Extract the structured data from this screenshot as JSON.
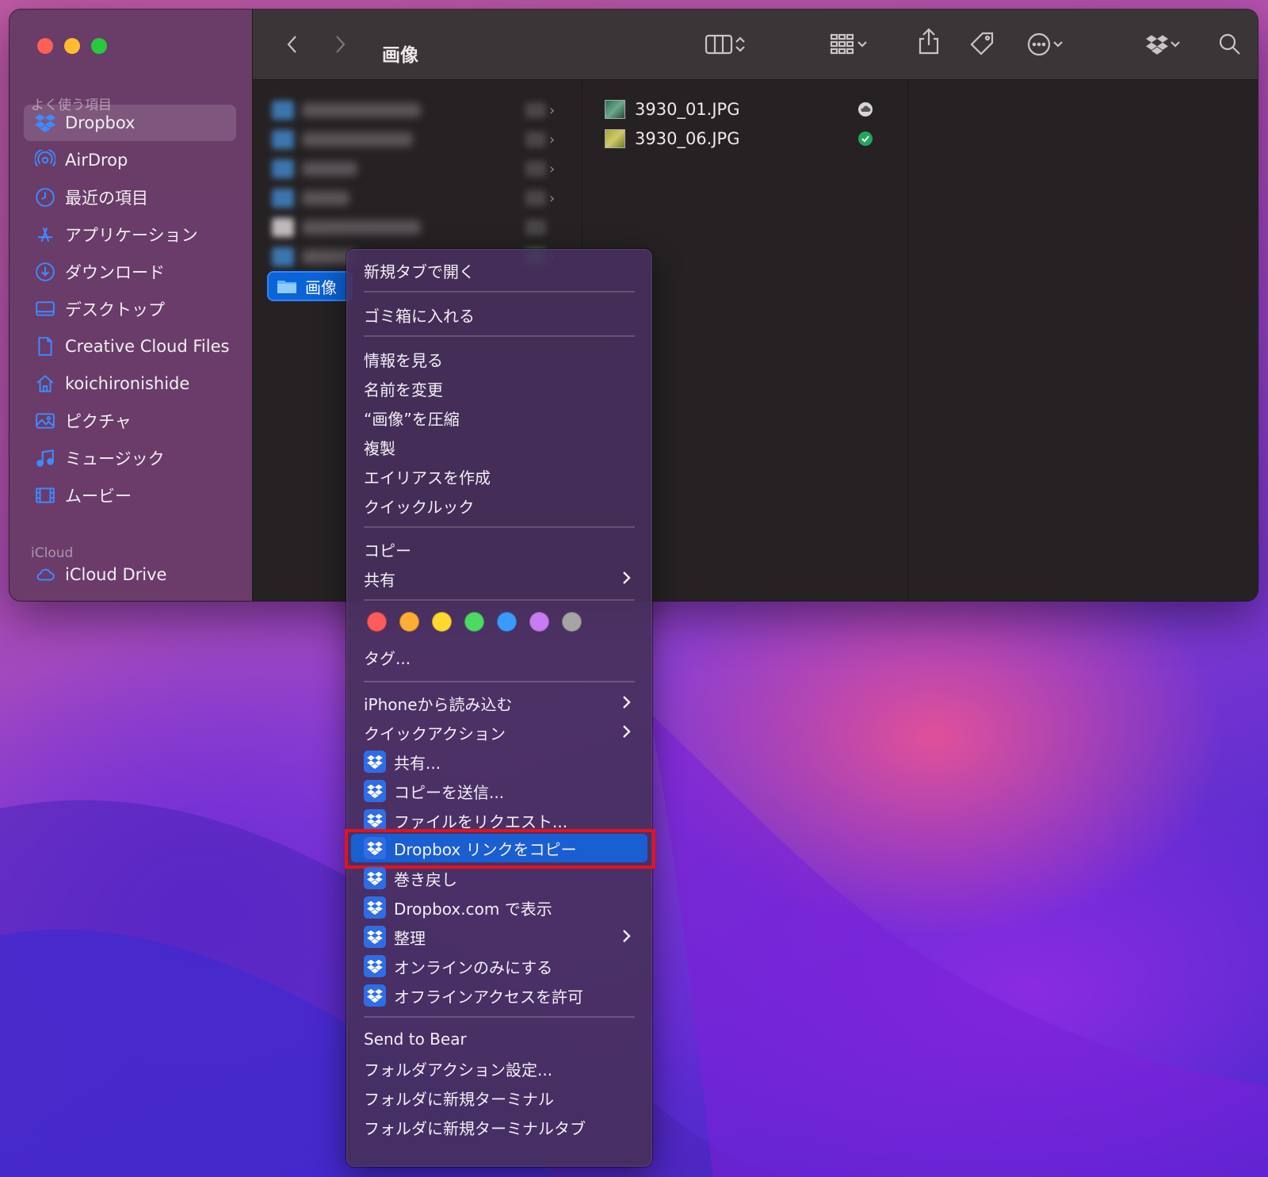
{
  "window": {
    "title": "画像",
    "traffic_lights": [
      "close",
      "minimize",
      "zoom"
    ]
  },
  "sidebar": {
    "favorites_header": "よく使う項目",
    "items": [
      {
        "label": "Dropbox",
        "icon": "dropbox-icon",
        "active": true
      },
      {
        "label": "AirDrop",
        "icon": "airdrop-icon"
      },
      {
        "label": "最近の項目",
        "icon": "clock-icon"
      },
      {
        "label": "アプリケーション",
        "icon": "apps-icon"
      },
      {
        "label": "ダウンロード",
        "icon": "download-icon"
      },
      {
        "label": "デスクトップ",
        "icon": "desktop-icon"
      },
      {
        "label": "Creative Cloud Files",
        "icon": "document-icon"
      },
      {
        "label": "koichironishide",
        "icon": "home-icon"
      },
      {
        "label": "ピクチャ",
        "icon": "photo-icon"
      },
      {
        "label": "ミュージック",
        "icon": "music-icon"
      },
      {
        "label": "ムービー",
        "icon": "film-icon"
      }
    ],
    "icloud_header": "iCloud",
    "icloud_items": [
      {
        "label": "iCloud Drive",
        "icon": "cloud-icon"
      }
    ]
  },
  "column1": {
    "selected_folder": "画像"
  },
  "column2": {
    "files": [
      {
        "name": "3930_01.JPG",
        "status": "cloud"
      },
      {
        "name": "3930_06.JPG",
        "status": "synced"
      }
    ]
  },
  "context_menu": {
    "items": {
      "open_new_tab": "新規タブで開く",
      "trash": "ゴミ箱に入れる",
      "get_info": "情報を見る",
      "rename": "名前を変更",
      "compress": "“画像”を圧縮",
      "duplicate": "複製",
      "make_alias": "エイリアスを作成",
      "quick_look": "クイックルック",
      "copy": "コピー",
      "share": "共有",
      "tags": "タグ...",
      "import_iphone": "iPhoneから読み込む",
      "quick_actions": "クイックアクション",
      "dbx_share": "共有...",
      "dbx_send_copy": "コピーを送信...",
      "dbx_request_files": "ファイルをリクエスト...",
      "dbx_copy_link": "Dropbox リンクをコピー",
      "dbx_rewind": "巻き戻し",
      "dbx_view_web": "Dropbox.com で表示",
      "dbx_organize": "整理",
      "dbx_online_only": "オンラインのみにする",
      "dbx_offline": "オフラインアクセスを許可",
      "send_to_bear": "Send to Bear",
      "folder_actions": "フォルダアクション設定...",
      "new_terminal": "フォルダに新規ターミナル",
      "new_terminal_tab": "フォルダに新規ターミナルタブ"
    },
    "tag_colors": [
      "#ff5b5b",
      "#ffae33",
      "#ffd92e",
      "#4cd964",
      "#3a9bff",
      "#c97cf2",
      "#a7a4a6"
    ],
    "highlighted_item": "dbx_copy_link",
    "accent": "#1a5fd1",
    "annotation_color": "#e5121c"
  }
}
